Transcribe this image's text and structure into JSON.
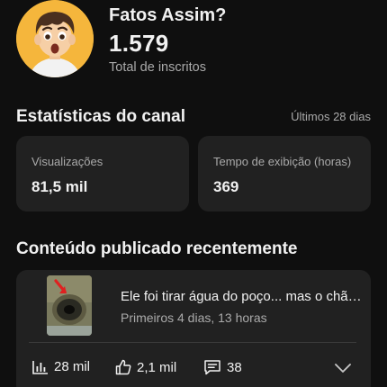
{
  "channel": {
    "name": "Fatos Assim?",
    "subscribers": "1.579",
    "subscribers_label": "Total de inscritos"
  },
  "stats": {
    "title": "Estatísticas do canal",
    "period": "Últimos 28 dias",
    "cards": [
      {
        "label": "Visualizações",
        "value": "81,5 mil"
      },
      {
        "label": "Tempo de exibição (horas)",
        "value": "369"
      }
    ]
  },
  "recent": {
    "title": "Conteúdo publicado recentemente",
    "video": {
      "title": "Ele foi tirar água do poço... mas o chão cedeu",
      "meta": "Primeiros 4 dias, 13 horas",
      "views": "28 mil",
      "likes": "2,1 mil",
      "comments": "38"
    }
  },
  "icons": {
    "views": "bar-chart-icon",
    "likes": "thumbs-up-icon",
    "comments": "comment-icon",
    "expand": "chevron-down-icon"
  },
  "colors": {
    "background": "#0f0f0f",
    "card": "#212121",
    "secondary_text": "#aaaaaa",
    "avatar_bg": "#f5b63c"
  }
}
